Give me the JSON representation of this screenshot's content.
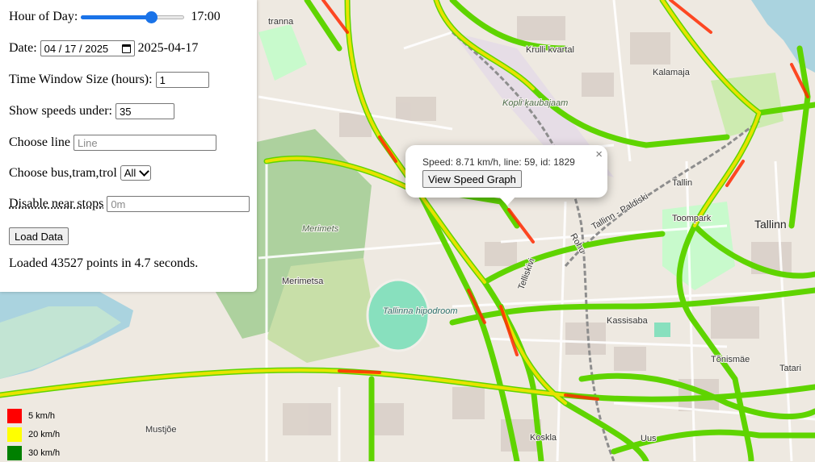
{
  "controls": {
    "hour_label": "Hour of Day:",
    "hour_value": "17:00",
    "hour_fraction": 0.708,
    "date_label": "Date:",
    "date_input": "04 / 17 / 2025",
    "date_display": "2025-04-17",
    "window_label": "Time Window Size (hours):",
    "window_value": "1",
    "speed_label": "Show speeds under:",
    "speed_value": "35",
    "line_label": "Choose line",
    "line_placeholder": "Line",
    "vehicle_label": "Choose bus,tram,trol",
    "vehicle_selected": "All",
    "near_label": "Disable near stops",
    "near_placeholder": "0m",
    "load_button": "Load Data",
    "status": "Loaded 43527 points in 4.7 seconds."
  },
  "popup": {
    "text": "Speed: 8.71 km/h, line: 59, id: 1829",
    "button": "View Speed Graph",
    "close": "×"
  },
  "legend": [
    {
      "label": "5 km/h",
      "color": "#ff0000"
    },
    {
      "label": "20 km/h",
      "color": "#ffff00"
    },
    {
      "label": "30 km/h",
      "color": "#008000"
    }
  ],
  "map": {
    "labels": {
      "tranna": "tranna",
      "krulli": "Krulli kvartal",
      "kalamaja": "Kalamaja",
      "kopli": "Kopli kaubajaam",
      "merimets": "Merimets",
      "merimetsa": "Merimetsa",
      "hipodroom": "Tallinna hipodroom",
      "tallinn": "Tallinn",
      "kassisaba": "Kassisaba",
      "tonismae": "Tõnismäe",
      "tatari": "Tatari",
      "mustjoe": "Mustjõe",
      "koskla": "Koskla",
      "telliskivi": "Telliskivi",
      "rohu": "Rohu",
      "tallinn_paldiski": "Tallinn - Paldiski",
      "toompark": "Toompark",
      "tallinn_station": "Tallin",
      "uus": "Uus"
    },
    "colors": {
      "slow": "#ff2a00",
      "mid": "#ffe600",
      "fast": "#5fd400"
    }
  }
}
